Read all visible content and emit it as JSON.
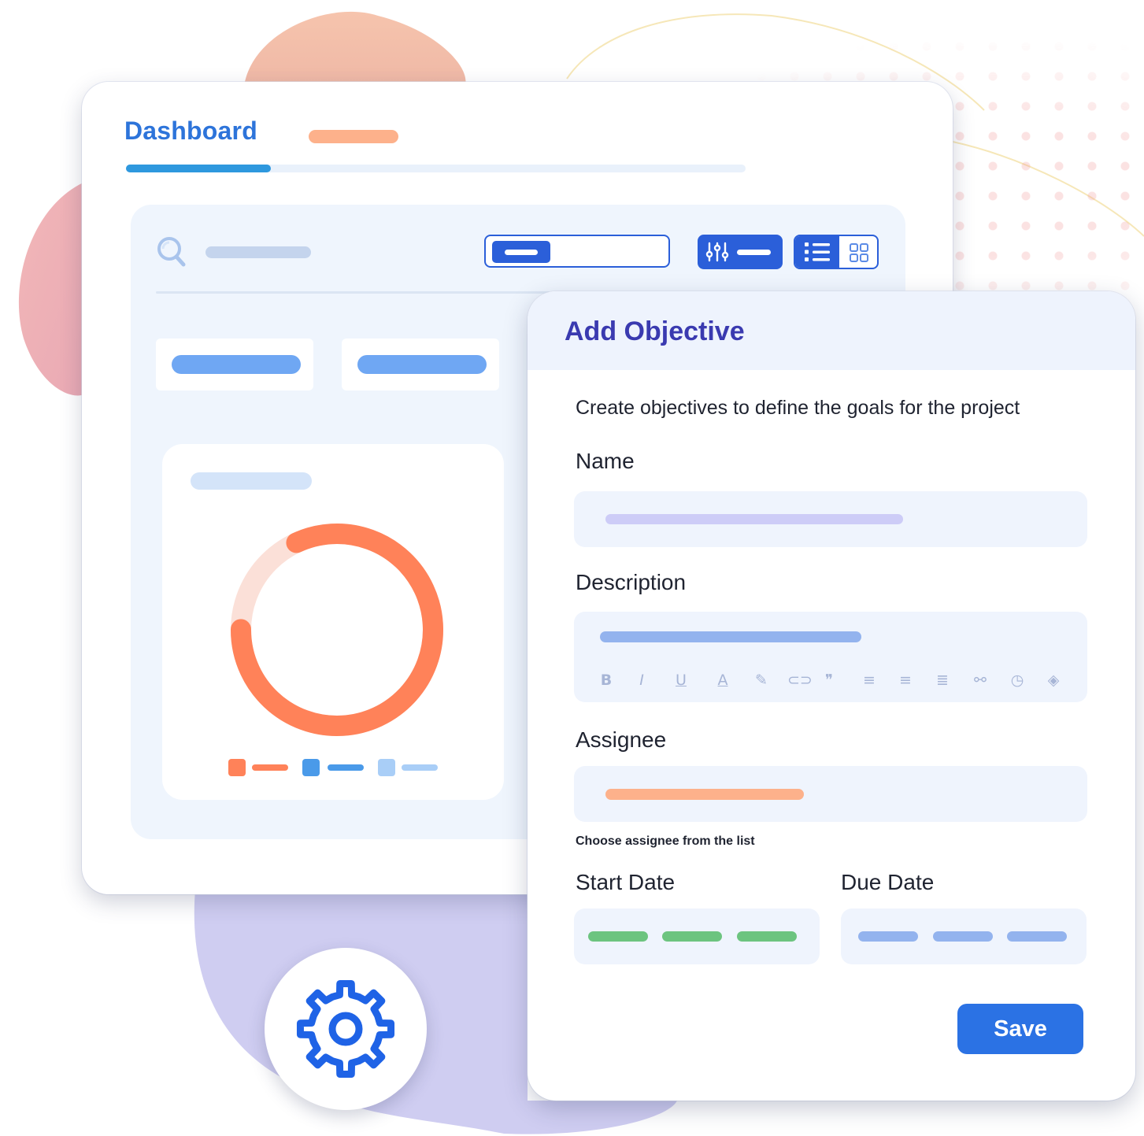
{
  "dashboard": {
    "title": "Dashboard"
  },
  "modal": {
    "title": "Add Objective",
    "description": "Create objectives to define the goals for the project",
    "fields": {
      "name_label": "Name",
      "description_label": "Description",
      "assignee_label": "Assignee",
      "assignee_hint": "Choose assignee from the list",
      "start_date_label": "Start Date",
      "due_date_label": "Due Date"
    },
    "editor_toolbar": [
      {
        "icon": "bold-icon",
        "glyph": "B"
      },
      {
        "icon": "italic-icon",
        "glyph": "I"
      },
      {
        "icon": "underline-icon",
        "glyph": "U"
      },
      {
        "icon": "text-color-icon",
        "glyph": "A"
      },
      {
        "icon": "highlight-icon",
        "glyph": "✎"
      },
      {
        "icon": "link-icon",
        "glyph": "⊂⊃"
      },
      {
        "icon": "quote-icon",
        "glyph": "❞"
      },
      {
        "icon": "align-left-icon",
        "glyph": "≡"
      },
      {
        "icon": "align-center-icon",
        "glyph": "≡"
      },
      {
        "icon": "align-justify-icon",
        "glyph": "≣"
      },
      {
        "icon": "unlink-icon",
        "glyph": "⚯"
      },
      {
        "icon": "clock-icon",
        "glyph": "◷"
      },
      {
        "icon": "fill-color-icon",
        "glyph": "◈"
      }
    ],
    "save_label": "Save"
  },
  "donut": {
    "progress_fraction": 0.82,
    "track_color": "#fbe0d8",
    "fill_color": "#ff8259"
  },
  "colors": {
    "accent": "#2b5fd9",
    "title_blue": "#2d74da",
    "modal_title": "#3a3ab0",
    "save": "#2b72e4"
  }
}
